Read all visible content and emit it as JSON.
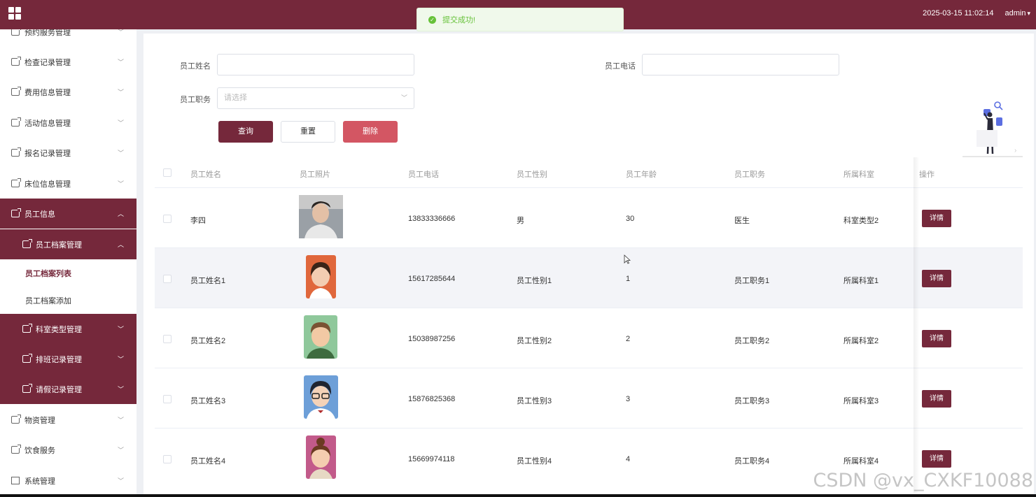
{
  "header": {
    "datetime": "2025-03-15 11:02:14",
    "user": "admin",
    "accent": "#75283b"
  },
  "toast": {
    "message": "提交成功!",
    "color": "#67c23a"
  },
  "sidebar": {
    "items": [
      {
        "label": "预约服务管理",
        "icon": "menu-doc-icon"
      },
      {
        "label": "检查记录管理",
        "icon": "menu-doc-icon"
      },
      {
        "label": "费用信息管理",
        "icon": "menu-doc-icon"
      },
      {
        "label": "活动信息管理",
        "icon": "menu-doc-icon"
      },
      {
        "label": "报名记录管理",
        "icon": "menu-doc-icon"
      },
      {
        "label": "床位信息管理",
        "icon": "menu-doc-icon"
      },
      {
        "label": "员工信息",
        "icon": "menu-doc-icon"
      },
      {
        "label": "员工档案管理",
        "icon": "menu-doc-icon"
      },
      {
        "label": "员工档案列表"
      },
      {
        "label": "员工档案添加"
      },
      {
        "label": "科室类型管理",
        "icon": "menu-doc-icon"
      },
      {
        "label": "排班记录管理",
        "icon": "menu-doc-icon"
      },
      {
        "label": "请假记录管理",
        "icon": "menu-doc-icon"
      },
      {
        "label": "物资管理",
        "icon": "menu-doc-icon"
      },
      {
        "label": "饮食服务",
        "icon": "menu-doc-icon"
      },
      {
        "label": "系统管理",
        "icon": "picture-icon"
      }
    ]
  },
  "search": {
    "name_label": "员工姓名",
    "phone_label": "员工电话",
    "job_label": "员工职务",
    "job_placeholder": "请选择",
    "query_btn": "查询",
    "reset_btn": "重置",
    "delete_btn": "删除",
    "delete_color": "#d35663"
  },
  "table": {
    "columns": [
      "员工姓名",
      "员工照片",
      "员工电话",
      "员工性别",
      "员工年龄",
      "员工职务",
      "所属科室",
      "操作"
    ],
    "detail_label": "详情",
    "rows": [
      {
        "name": "李四",
        "photo": "photo-real",
        "phone": "13833336666",
        "gender": "男",
        "age": "30",
        "job": "医生",
        "dept": "科室类型2"
      },
      {
        "name": "员工姓名1",
        "photo": "avatar-girl",
        "phone": "15617285644",
        "gender": "员工性别1",
        "age": "1",
        "job": "员工职务1",
        "dept": "所属科室1"
      },
      {
        "name": "员工姓名2",
        "photo": "avatar-man",
        "phone": "15038987256",
        "gender": "员工性别2",
        "age": "2",
        "job": "员工职务2",
        "dept": "所属科室2"
      },
      {
        "name": "员工姓名3",
        "photo": "avatar-glasses",
        "phone": "15876825368",
        "gender": "员工性别3",
        "age": "3",
        "job": "员工职务3",
        "dept": "所属科室3"
      },
      {
        "name": "员工姓名4",
        "photo": "avatar-bun",
        "phone": "15669974118",
        "gender": "员工性别4",
        "age": "4",
        "job": "员工职务4",
        "dept": "所属科室4"
      }
    ]
  },
  "watermark": "CSDN @vx_CXKF10088"
}
